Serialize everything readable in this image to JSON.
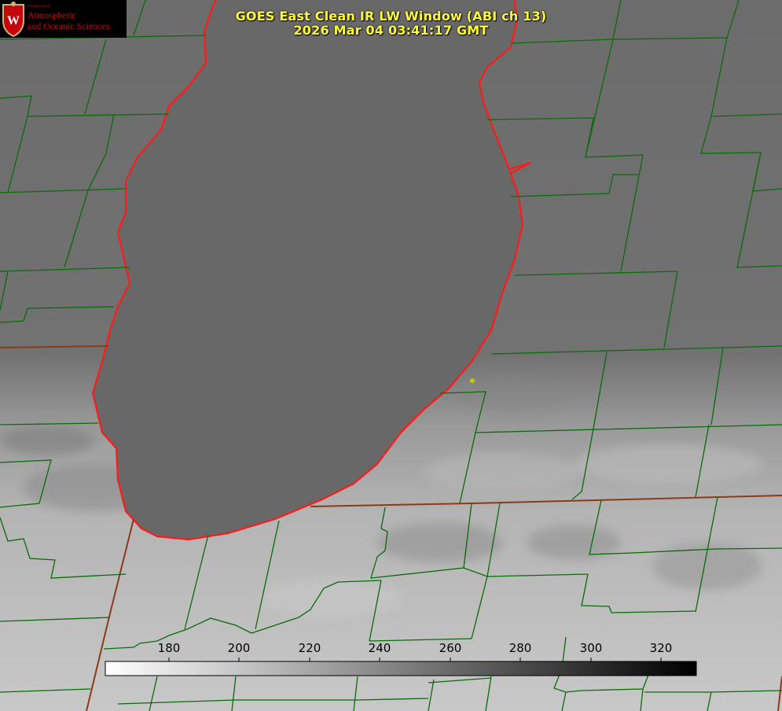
{
  "title": {
    "line1": "GOES East Clean IR LW Window (ABI ch 13)",
    "line2": "2026 Mar 04 03:41:17 GMT"
  },
  "logo": {
    "emblem_letter": "W",
    "department": "Department of",
    "line1": "Atmospheric",
    "line2": "and Oceanic Sciences"
  },
  "colorbar": {
    "min": 163,
    "max": 330,
    "ticks": [
      "180",
      "200",
      "220",
      "240",
      "260",
      "280",
      "300",
      "320"
    ],
    "gradient": "white-to-black"
  },
  "colors": {
    "title": "#ffff33",
    "county_lines": "#006400",
    "lake_outline": "#ff1a1a",
    "state_lines": "#8b3a1a",
    "logo_red": "#c5050c",
    "marker": "#c8c800"
  }
}
